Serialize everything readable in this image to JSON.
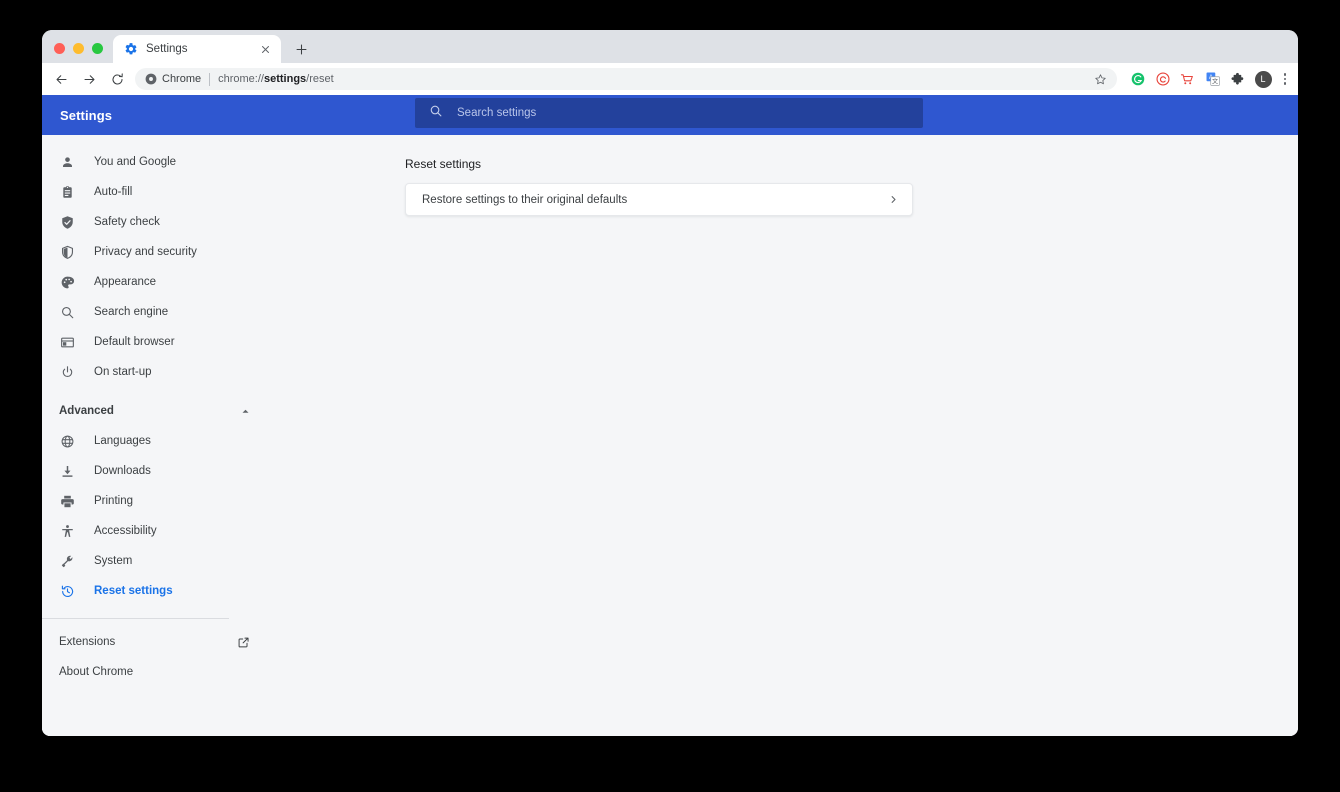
{
  "browser": {
    "tab": {
      "title": "Settings",
      "favicon_icon": "gear-icon",
      "close_icon": "close-icon"
    },
    "new_tab_label": "+",
    "nav": {
      "back_icon": "back-arrow-icon",
      "forward_icon": "forward-arrow-icon",
      "reload_icon": "reload-icon"
    },
    "omnibox": {
      "chip_icon": "chrome-logo-icon",
      "chip_label": "Chrome",
      "url_prefix": "chrome://",
      "url_bold": "settings",
      "url_suffix": "/reset",
      "star_icon": "bookmark-star-icon"
    },
    "extensions": [
      {
        "name": "grammarly-extension-icon",
        "glyph": "G",
        "color": "#15c26b"
      },
      {
        "name": "spiral-extension-icon",
        "glyph": "",
        "color": "#e8453c"
      },
      {
        "name": "shopping-cart-extension-icon",
        "glyph": "",
        "color": "#e8453c"
      },
      {
        "name": "google-translate-extension-icon",
        "glyph": "",
        "color": "#4285f4"
      },
      {
        "name": "puzzle-extensions-icon",
        "glyph": "",
        "color": "#3c4043"
      }
    ],
    "avatar_label": "L",
    "menu_icon": "three-dot-menu-icon"
  },
  "header": {
    "title": "Settings",
    "search": {
      "placeholder": "Search settings",
      "value": "",
      "icon": "search-icon"
    },
    "background_color": "#2f57d0",
    "search_background_color": "#23419c"
  },
  "sidebar": {
    "items": [
      {
        "label": "You and Google",
        "icon": "person-icon",
        "active": false
      },
      {
        "label": "Auto-fill",
        "icon": "clipboard-icon",
        "active": false
      },
      {
        "label": "Safety check",
        "icon": "shield-check-icon",
        "active": false
      },
      {
        "label": "Privacy and security",
        "icon": "shield-outline-icon",
        "active": false
      },
      {
        "label": "Appearance",
        "icon": "palette-icon",
        "active": false
      },
      {
        "label": "Search engine",
        "icon": "magnifier-icon",
        "active": false
      },
      {
        "label": "Default browser",
        "icon": "browser-window-icon",
        "active": false
      },
      {
        "label": "On start-up",
        "icon": "power-icon",
        "active": false
      }
    ],
    "advanced": {
      "label": "Advanced",
      "expanded": true,
      "caret_icon": "chevron-up-icon",
      "items": [
        {
          "label": "Languages",
          "icon": "globe-icon",
          "active": false
        },
        {
          "label": "Downloads",
          "icon": "download-icon",
          "active": false
        },
        {
          "label": "Printing",
          "icon": "printer-icon",
          "active": false
        },
        {
          "label": "Accessibility",
          "icon": "accessibility-icon",
          "active": false
        },
        {
          "label": "System",
          "icon": "wrench-icon",
          "active": false
        },
        {
          "label": "Reset settings",
          "icon": "restore-history-icon",
          "active": true
        }
      ]
    },
    "footer": {
      "extensions_label": "Extensions",
      "extensions_icon": "external-link-icon",
      "about_label": "About Chrome"
    },
    "active_color": "#1a73e8"
  },
  "main": {
    "section_title": "Reset settings",
    "card": {
      "label": "Restore settings to their original defaults",
      "chevron_icon": "chevron-right-icon"
    }
  }
}
